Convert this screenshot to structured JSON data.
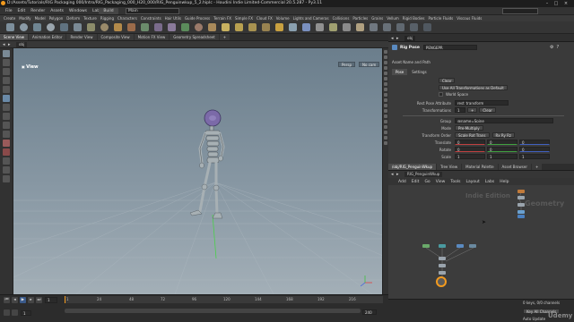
{
  "title_bar": {
    "title": "D:/Assets/Tutorials/RIG Packaging 000/Intro/RIG_Packaging_000_H20_000/RIG_Penguinwkup_5_2.hipIc - Houdini Indie Limited-Commercial 20.5.287 - Py3.11"
  },
  "menubar": {
    "items": [
      "File",
      "Edit",
      "Render",
      "Assets",
      "Windows",
      "Labs",
      "Help"
    ],
    "build_label": "Build",
    "desk_label": "Main"
  },
  "shelf": {
    "tabs": [
      "Create",
      "Modify",
      "Model",
      "Polygon",
      "Deform",
      "Texture",
      "Rigging",
      "Characters",
      "Constraints",
      "Hair Utils",
      "Guide Process",
      "Terrain FX",
      "Simple FX",
      "Cloud FX",
      "Volume",
      "Lights and Cameras",
      "Collisions",
      "Particles",
      "Grains",
      "Vellum",
      "Rigid Bodies",
      "Particle Fluids",
      "Viscous Fluids",
      "Oceans"
    ]
  },
  "scene_view": {
    "tabs": [
      "Scene View",
      "Animation Editor",
      "Render View",
      "Composite View",
      "Motion FX View",
      "Geometry Spreadsheet"
    ],
    "path": "obj",
    "viewport_label": "View",
    "persp_label": "Persp",
    "cam_label": "No cam"
  },
  "parameters": {
    "path": "obj",
    "node_type": "Rig Pose",
    "node_name": "PENGEPR",
    "tabs": [
      "Pose",
      "Settings"
    ],
    "asset_name_label": "Asset Name and Path",
    "rows": [
      {
        "label": "",
        "value": "Clear"
      },
      {
        "label": "",
        "value": "Use All Transformations as Default"
      },
      {
        "label": "",
        "value": "World Space"
      },
      {
        "label": "Rest Pose Attribute",
        "value": "rest_transform"
      },
      {
        "label": "Transformations",
        "value": "1"
      },
      {
        "label": "Group",
        "value": "@name=Spine"
      },
      {
        "label": "Mode",
        "value": "Pre-Multiply"
      },
      {
        "label": "Transform Order",
        "value": "Scale Rot Trans"
      },
      {
        "label": "Translate",
        "value": "0"
      },
      {
        "label": "Rotate",
        "value": "0"
      },
      {
        "label": "Scale",
        "value": "1"
      }
    ],
    "rot_order": "Rx Ry Rz"
  },
  "network": {
    "tabs": [
      "/obj/RIG_PenguinWkup",
      "Tree View",
      "Material Palette",
      "Asset Browser"
    ],
    "path": "RIG_PenguinWkup",
    "menu": [
      "Add",
      "Edit",
      "Go",
      "View",
      "Tools",
      "Layout",
      "Labs",
      "Help"
    ],
    "context_label": "Indie Edition",
    "geometry_label": "Geometry"
  },
  "timeline": {
    "frame": "1",
    "ticks": [
      "1",
      "24",
      "48",
      "72",
      "96",
      "120",
      "144",
      "168",
      "192",
      "216"
    ],
    "start": "1",
    "end": "240",
    "keys_label": "0 keys, 0/0 channels",
    "key_all_label": "Key All Channels",
    "auto_update": "Auto Update"
  },
  "colors": {
    "accent": "#f29a1e",
    "viewport_top": "#6b7e8c",
    "viewport_bottom": "#a3afb7",
    "character_body": "#a7b0b4",
    "character_head": "#7b6aa8"
  },
  "watermark": "Udemy"
}
